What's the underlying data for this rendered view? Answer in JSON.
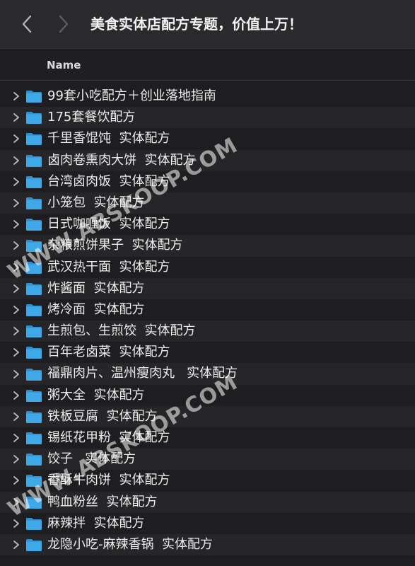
{
  "window": {
    "title": "美食实体店配方专题，价值上万！"
  },
  "toolbar": {
    "back_icon": "chevron-left-icon",
    "forward_icon": "chevron-right-icon"
  },
  "header": {
    "name_column": "Name"
  },
  "folders": [
    {
      "label": "99套小吃配方＋创业落地指南"
    },
    {
      "label": "175套餐饮配方"
    },
    {
      "label": "千里香馄饨  实体配方"
    },
    {
      "label": "卤肉卷熏肉大饼  实体配方"
    },
    {
      "label": "台湾卤肉饭  实体配方"
    },
    {
      "label": "小笼包  实体配方"
    },
    {
      "label": "日式咖喱饭  实体配方"
    },
    {
      "label": "杂粮煎饼果子  实体配方"
    },
    {
      "label": "武汉热干面  实体配方"
    },
    {
      "label": "炸酱面  实体配方"
    },
    {
      "label": "烤冷面  实体配方"
    },
    {
      "label": "生煎包、生煎饺  实体配方"
    },
    {
      "label": "百年老卤菜  实体配方"
    },
    {
      "label": "福鼎肉片、温州瘦肉丸   实体配方"
    },
    {
      "label": "粥大全  实体配方"
    },
    {
      "label": "铁板豆腐  实体配方"
    },
    {
      "label": "锡纸花甲粉  实体配方"
    },
    {
      "label": "饺子   实体配方"
    },
    {
      "label": "香酥牛肉饼  实体配方"
    },
    {
      "label": "鸭血粉丝  实体配方"
    },
    {
      "label": "麻辣拌  实体配方"
    },
    {
      "label": "龙隐小吃-麻辣香锅  实体配方"
    }
  ],
  "watermarks": [
    "WWW.ABSKOOP.COM",
    "WWW.ABSKOOP.COM"
  ],
  "colors": {
    "folder": "#3fa9e8",
    "folder_tab": "#2f8fd0"
  }
}
